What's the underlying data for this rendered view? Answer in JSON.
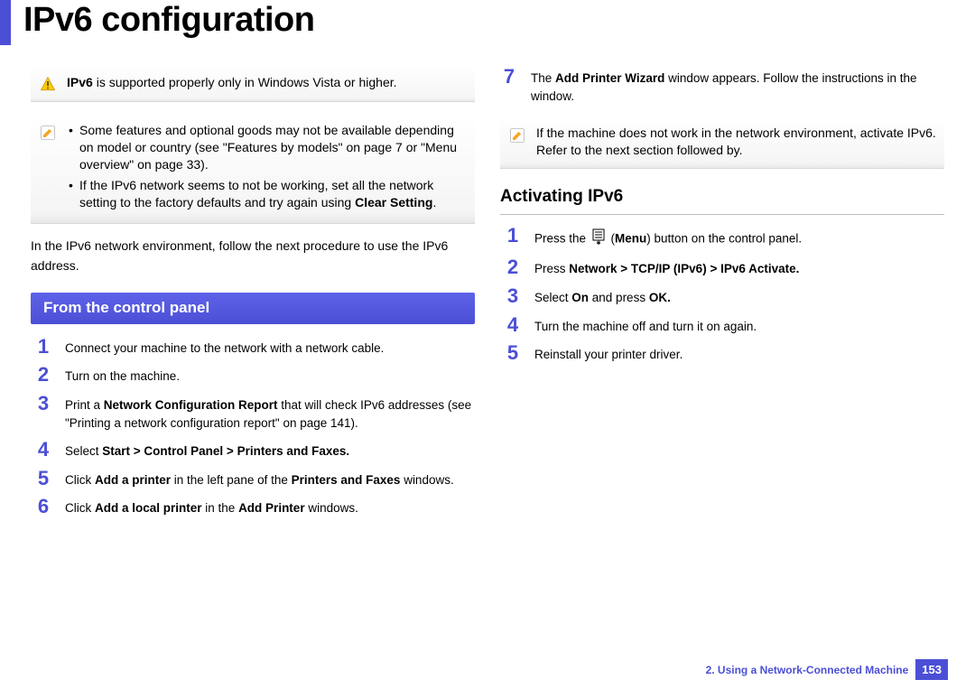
{
  "title": "IPv6 configuration",
  "warning_text": "IPv6 is supported properly only in Windows Vista or higher.",
  "note_bullets": [
    "Some features and optional goods may not be available depending on model or country (see \"Features by models\" on page 7 or \"Menu overview\" on page 33).",
    "If the IPv6 network seems to not be working, set all the network setting to the factory defaults and try again using Clear Setting."
  ],
  "intro": "In the IPv6 network environment, follow the next procedure to use the IPv6 address.",
  "section1_title": "From the control panel",
  "steps_left": {
    "s1": "Connect your machine to the network with a network cable.",
    "s2": "Turn on the machine.",
    "s3a": "Print a ",
    "s3b": "Network Configuration Report",
    "s3c": " that will check IPv6 addresses (see \"Printing a network configuration report\" on page 141).",
    "s4a": "Select ",
    "s4b": "Start > Control Panel > Printers and Faxes.",
    "s5a": "Click ",
    "s5b": "Add a printer",
    "s5c": " in the left pane of the ",
    "s5d": "Printers and Faxes",
    "s5e": " windows.",
    "s6a": "Click ",
    "s6b": "Add a local printer",
    "s6c": " in the ",
    "s6d": "Add Printer",
    "s6e": " windows."
  },
  "step7a": "The ",
  "step7b": "Add Printer Wizard",
  "step7c": " window appears. Follow the instructions in the window.",
  "note2": "If the machine does not work in the network environment, activate IPv6. Refer to the next section followed by.",
  "section2_title": "Activating IPv6",
  "steps_right": {
    "r1a": "Press the ",
    "r1b": "Menu",
    "r1c": ") button on the control panel.",
    "r2a": "Press ",
    "r2b": "Network > TCP/IP (IPv6) > IPv6 Activate.",
    "r3a": "Select ",
    "r3b": "On",
    "r3c": " and press ",
    "r3d": "OK.",
    "r4": "Turn the machine off and turn it on again.",
    "r5": "Reinstall your printer driver."
  },
  "footer_chapter": "2.  Using a Network-Connected Machine",
  "footer_page": "153"
}
